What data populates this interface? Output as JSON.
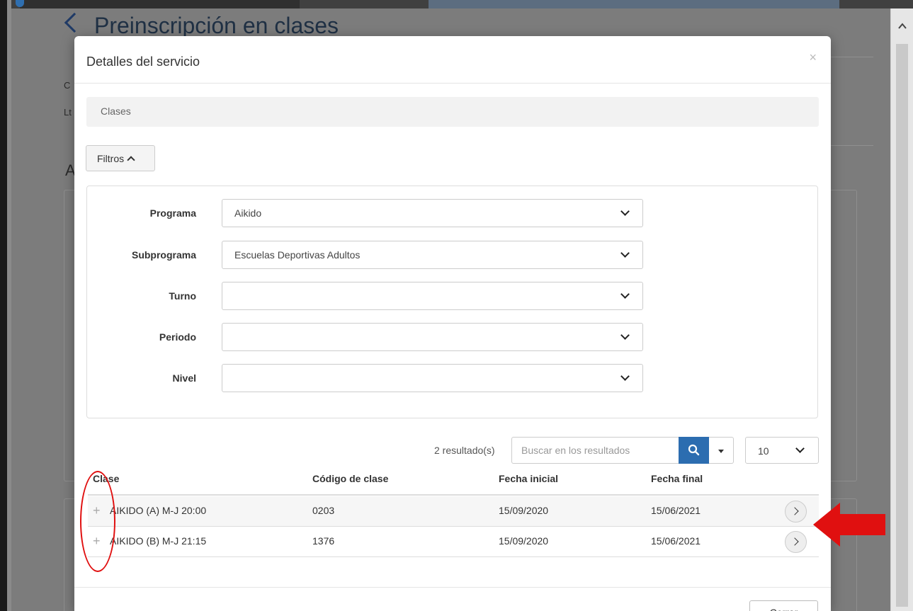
{
  "background": {
    "page_title": "Preinscripción en clases",
    "frag_1": "C",
    "frag_2": "Lt",
    "frag_3": "A"
  },
  "modal": {
    "title": "Detalles del servicio",
    "close": "×",
    "breadcrumb": "Clases",
    "filters_button": "Filtros",
    "filters": [
      {
        "label": "Programa",
        "value": "Aikido"
      },
      {
        "label": "Subprograma",
        "value": "Escuelas Deportivas Adultos"
      },
      {
        "label": "Turno",
        "value": ""
      },
      {
        "label": "Periodo",
        "value": ""
      },
      {
        "label": "Nivel",
        "value": ""
      }
    ],
    "results_count": "2 resultado(s)",
    "search_placeholder": "Buscar en los resultados",
    "page_size": "10",
    "table": {
      "headers": [
        "Clase",
        "Código de clase",
        "Fecha inicial",
        "Fecha final"
      ],
      "rows": [
        {
          "clase": "AIKIDO (A) M-J 20:00",
          "codigo": "0203",
          "fecha_inicial": "15/09/2020",
          "fecha_final": "15/06/2021"
        },
        {
          "clase": "AIKIDO (B) M-J 21:15",
          "codigo": "1376",
          "fecha_inicial": "15/09/2020",
          "fecha_final": "15/06/2021"
        }
      ]
    },
    "footer_button": "Cerrar"
  },
  "colors": {
    "accent": "#2c6db0",
    "annotation": "#e01010"
  }
}
